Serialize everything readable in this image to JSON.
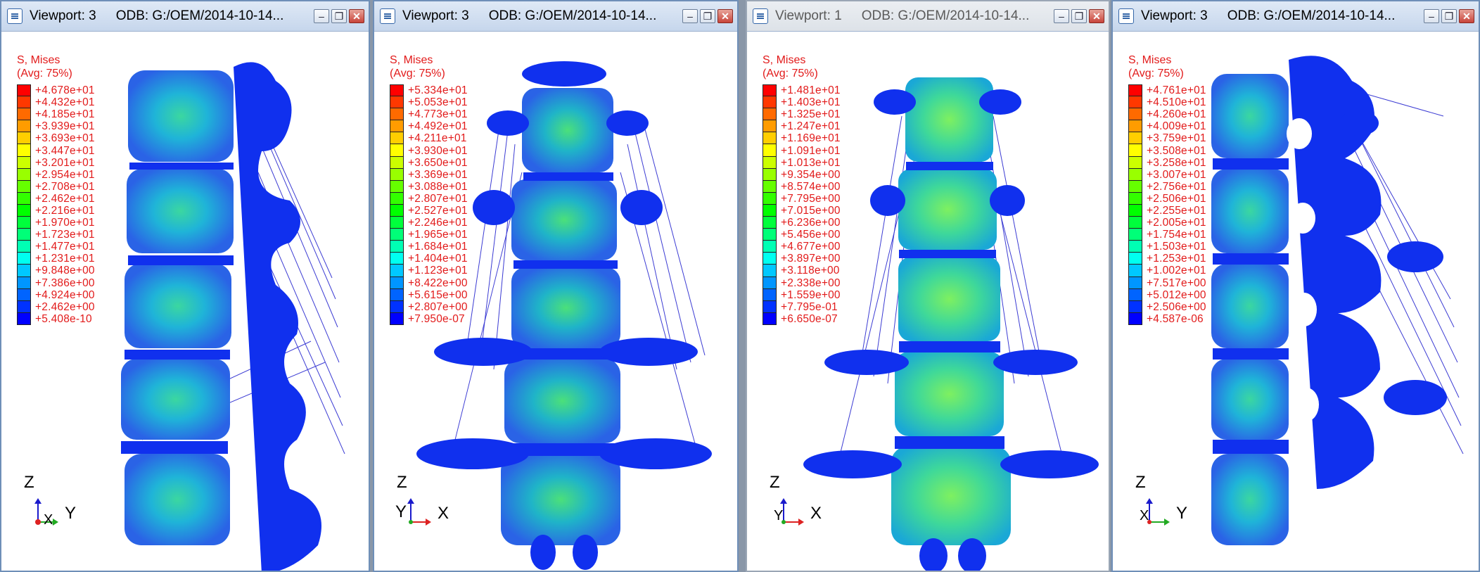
{
  "viewports": [
    {
      "title": "Viewport: 3",
      "odb": "ODB: G:/OEM/2014-10-14...",
      "legend_title": "S, Mises",
      "legend_avg": "(Avg: 75%)",
      "legend_values": [
        "+4.678e+01",
        "+4.432e+01",
        "+4.185e+01",
        "+3.939e+01",
        "+3.693e+01",
        "+3.447e+01",
        "+3.201e+01",
        "+2.954e+01",
        "+2.708e+01",
        "+2.462e+01",
        "+2.216e+01",
        "+1.970e+01",
        "+1.723e+01",
        "+1.477e+01",
        "+1.231e+01",
        "+9.848e+00",
        "+7.386e+00",
        "+4.924e+00",
        "+2.462e+00",
        "+5.408e-10"
      ],
      "axis_up": "Z",
      "axis_side": "Y",
      "axis_corner": "X",
      "active": true
    },
    {
      "title": "Viewport: 3",
      "odb": "ODB: G:/OEM/2014-10-14...",
      "legend_title": "S, Mises",
      "legend_avg": "(Avg: 75%)",
      "legend_values": [
        "+5.334e+01",
        "+5.053e+01",
        "+4.773e+01",
        "+4.492e+01",
        "+4.211e+01",
        "+3.930e+01",
        "+3.650e+01",
        "+3.369e+01",
        "+3.088e+01",
        "+2.807e+01",
        "+2.527e+01",
        "+2.246e+01",
        "+1.965e+01",
        "+1.684e+01",
        "+1.404e+01",
        "+1.123e+01",
        "+8.422e+00",
        "+5.615e+00",
        "+2.807e+00",
        "+7.950e-07"
      ],
      "axis_up": "Z",
      "axis_side": "X",
      "axis_corner": "Y",
      "active": true
    },
    {
      "title": "Viewport: 1",
      "odb": "ODB: G:/OEM/2014-10-14...",
      "legend_title": "S, Mises",
      "legend_avg": "(Avg: 75%)",
      "legend_values": [
        "+1.481e+01",
        "+1.403e+01",
        "+1.325e+01",
        "+1.247e+01",
        "+1.169e+01",
        "+1.091e+01",
        "+1.013e+01",
        "+9.354e+00",
        "+8.574e+00",
        "+7.795e+00",
        "+7.015e+00",
        "+6.236e+00",
        "+5.456e+00",
        "+4.677e+00",
        "+3.897e+00",
        "+3.118e+00",
        "+2.338e+00",
        "+1.559e+00",
        "+7.795e-01",
        "+6.650e-07"
      ],
      "axis_up": "Z",
      "axis_side": "X",
      "axis_corner": "Y",
      "active": false
    },
    {
      "title": "Viewport: 3",
      "odb": "ODB: G:/OEM/2014-10-14...",
      "legend_title": "S, Mises",
      "legend_avg": "(Avg: 75%)",
      "legend_values": [
        "+4.761e+01",
        "+4.510e+01",
        "+4.260e+01",
        "+4.009e+01",
        "+3.759e+01",
        "+3.508e+01",
        "+3.258e+01",
        "+3.007e+01",
        "+2.756e+01",
        "+2.506e+01",
        "+2.255e+01",
        "+2.005e+01",
        "+1.754e+01",
        "+1.503e+01",
        "+1.253e+01",
        "+1.002e+01",
        "+7.517e+00",
        "+5.012e+00",
        "+2.506e+00",
        "+4.587e-06"
      ],
      "axis_up": "Z",
      "axis_side": "Y",
      "axis_corner": "X",
      "active": true
    }
  ],
  "legend_colors": [
    "#ff0000",
    "#ff3800",
    "#ff6a00",
    "#ff9c00",
    "#ffce00",
    "#ffff00",
    "#ccff00",
    "#99ff00",
    "#66ff00",
    "#33ff00",
    "#00ff00",
    "#00ff3c",
    "#00ff78",
    "#00ffb4",
    "#00fff0",
    "#00c8ff",
    "#0096ff",
    "#0064ff",
    "#0032ff",
    "#0000ff"
  ],
  "window_buttons": [
    "minimize-icon",
    "restore-icon",
    "close-icon"
  ]
}
